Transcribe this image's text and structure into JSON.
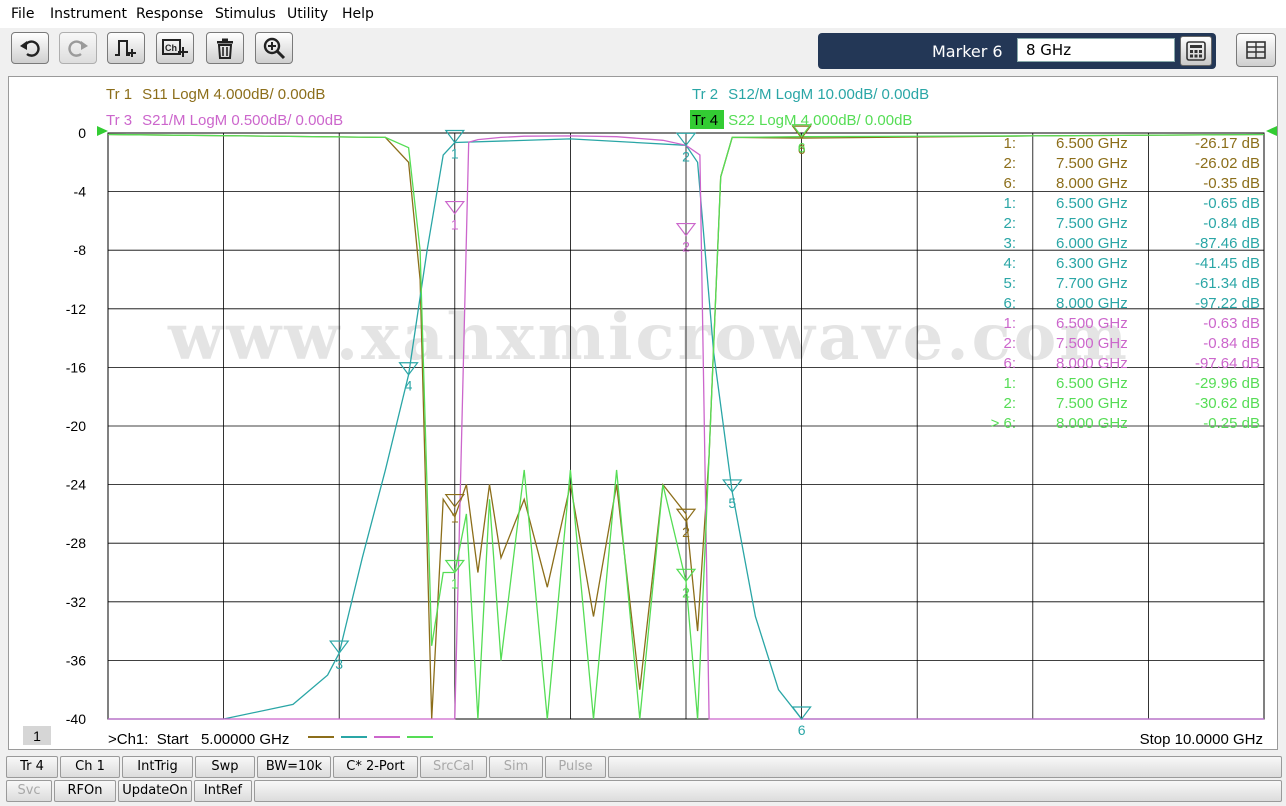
{
  "menu": [
    "File",
    "Instrument",
    "Response",
    "Stimulus",
    "Utility",
    "Help"
  ],
  "toolbar": {
    "buttons": [
      {
        "name": "undo-button",
        "icon": "undo-icon",
        "disabled": false
      },
      {
        "name": "redo-button",
        "icon": "redo-icon",
        "disabled": true
      },
      {
        "name": "add-trace-button",
        "icon": "add-trace-icon",
        "disabled": false
      },
      {
        "name": "add-channel-button",
        "icon": "add-channel-icon",
        "disabled": false
      },
      {
        "name": "delete-button",
        "icon": "trash-icon",
        "disabled": false
      },
      {
        "name": "zoom-button",
        "icon": "zoom-icon",
        "disabled": false
      }
    ],
    "marker_label": "Marker 6",
    "marker_value": "8 GHz"
  },
  "traces": {
    "tr1": {
      "id": "Tr  1",
      "desc": "S11 LogM 4.000dB/  0.00dB",
      "color": "#8c6e1a"
    },
    "tr2": {
      "id": "Tr  2",
      "desc": "S12/M LogM 10.00dB/  0.00dB",
      "color": "#2aa6a6"
    },
    "tr3": {
      "id": "Tr  3",
      "desc": "S21/M LogM 0.500dB/  0.00dB",
      "color": "#cc66cc"
    },
    "tr4": {
      "id": "Tr  4",
      "desc": "S22 LogM 4.000dB/  0.00dB",
      "color": "#55dd55"
    }
  },
  "chart_data": {
    "type": "line",
    "xlim": [
      5.0,
      10.0
    ],
    "ylim": [
      -40,
      0
    ],
    "yticks": [
      "0",
      "-4",
      "-8",
      "-12",
      "-16",
      "-20",
      "-24",
      "-28",
      "-32",
      "-36",
      "-40"
    ],
    "series": [
      {
        "name": "S11",
        "color": "#8c6e1a",
        "x": [
          5.0,
          6.2,
          6.3,
          6.35,
          6.4,
          6.45,
          6.5,
          6.55,
          6.6,
          6.65,
          6.7,
          6.8,
          6.9,
          7.0,
          7.1,
          7.2,
          7.3,
          7.4,
          7.5,
          7.55,
          7.6,
          7.65,
          7.7,
          8.0,
          9.0,
          10.0
        ],
        "y": [
          -0.1,
          -0.3,
          -2,
          -10,
          -40,
          -25,
          -26.2,
          -24,
          -30,
          -24,
          -29,
          -25,
          -31,
          -24,
          -33,
          -24,
          -38,
          -24,
          -26,
          -34,
          -22,
          -3,
          -0.3,
          -0.35,
          -0.2,
          -0.1
        ]
      },
      {
        "name": "S12",
        "color": "#2aa6a6",
        "x": [
          5.0,
          5.5,
          5.8,
          5.95,
          6.0,
          6.1,
          6.2,
          6.3,
          6.38,
          6.45,
          6.5,
          7.0,
          7.5,
          7.55,
          7.62,
          7.7,
          7.8,
          7.9,
          8.0,
          8.2,
          8.5,
          9.0,
          9.5,
          10.0
        ],
        "y": [
          -40,
          -40,
          -39,
          -37,
          -35.5,
          -29,
          -23,
          -16.5,
          -8,
          -1.5,
          -0.65,
          -0.4,
          -0.84,
          -2,
          -15,
          -24.5,
          -33,
          -38,
          -40,
          -40,
          -40,
          -40,
          -40,
          -40
        ]
      },
      {
        "name": "S21",
        "color": "#cc66cc",
        "x": [
          5.0,
          6.5,
          6.56,
          6.6,
          6.7,
          6.8,
          7.0,
          7.2,
          7.4,
          7.5,
          7.56,
          7.6,
          10.0
        ],
        "y": [
          -40,
          -40,
          -0.63,
          -0.45,
          -0.3,
          -0.22,
          -0.2,
          -0.25,
          -0.5,
          -0.84,
          -1.5,
          -40,
          -40
        ]
      },
      {
        "name": "S22",
        "color": "#55dd55",
        "x": [
          5.0,
          6.2,
          6.3,
          6.35,
          6.4,
          6.45,
          6.5,
          6.55,
          6.6,
          6.65,
          6.7,
          6.8,
          6.9,
          7.0,
          7.1,
          7.2,
          7.3,
          7.4,
          7.5,
          7.55,
          7.6,
          7.65,
          7.7,
          8.0,
          9.0,
          10.0
        ],
        "y": [
          -0.1,
          -0.3,
          -1,
          -8,
          -35,
          -30,
          -30,
          -26,
          -40,
          -25,
          -36,
          -23,
          -40,
          -23,
          -40,
          -23,
          -40,
          -24,
          -30.6,
          -40,
          -22,
          -3,
          -0.3,
          -0.25,
          -0.2,
          -0.1
        ]
      }
    ],
    "markers": [
      {
        "label": "1",
        "trace": "S12",
        "x": 6.5,
        "y": -0.65
      },
      {
        "label": "2",
        "trace": "S12",
        "x": 7.5,
        "y": -0.84
      },
      {
        "label": "3",
        "trace": "S12",
        "x": 6.0,
        "y": -35.5
      },
      {
        "label": "4",
        "trace": "S12",
        "x": 6.3,
        "y": -16.5
      },
      {
        "label": "5",
        "trace": "S12",
        "x": 7.7,
        "y": -24.5
      },
      {
        "label": "6",
        "trace": "S12",
        "x": 8.0,
        "y": -40
      },
      {
        "label": "1",
        "trace": "S21",
        "x": 6.5,
        "y": -5.5
      },
      {
        "label": "2",
        "trace": "S21",
        "x": 7.5,
        "y": -7.0
      },
      {
        "label": "1",
        "trace": "S11",
        "x": 6.5,
        "y": -25.5
      },
      {
        "label": "2",
        "trace": "S11",
        "x": 7.5,
        "y": -26.5
      },
      {
        "label": "6",
        "trace": "S11",
        "x": 8.0,
        "y": -0.35
      },
      {
        "label": "1",
        "trace": "S22",
        "x": 6.5,
        "y": -30
      },
      {
        "label": "2",
        "trace": "S22",
        "x": 7.5,
        "y": -30.6
      },
      {
        "label": "6",
        "trace": "S22",
        "x": 8.0,
        "y": -0.25
      }
    ],
    "marker_readouts": [
      {
        "n": "1:",
        "f": "6.500  GHz",
        "v": "-26.17 dB",
        "color": "#8c6e1a"
      },
      {
        "n": "2:",
        "f": "7.500  GHz",
        "v": "-26.02 dB",
        "color": "#8c6e1a"
      },
      {
        "n": "6:",
        "f": "8.000  GHz",
        "v": "-0.35 dB",
        "color": "#8c6e1a"
      },
      {
        "n": "1:",
        "f": "6.500  GHz",
        "v": "-0.65 dB",
        "color": "#2aa6a6"
      },
      {
        "n": "2:",
        "f": "7.500  GHz",
        "v": "-0.84 dB",
        "color": "#2aa6a6"
      },
      {
        "n": "3:",
        "f": "6.000  GHz",
        "v": "-87.46 dB",
        "color": "#2aa6a6"
      },
      {
        "n": "4:",
        "f": "6.300  GHz",
        "v": "-41.45 dB",
        "color": "#2aa6a6"
      },
      {
        "n": "5:",
        "f": "7.700  GHz",
        "v": "-61.34 dB",
        "color": "#2aa6a6"
      },
      {
        "n": "6:",
        "f": "8.000  GHz",
        "v": "-97.22 dB",
        "color": "#2aa6a6"
      },
      {
        "n": "1:",
        "f": "6.500  GHz",
        "v": "-0.63 dB",
        "color": "#cc66cc"
      },
      {
        "n": "2:",
        "f": "7.500  GHz",
        "v": "-0.84 dB",
        "color": "#cc66cc"
      },
      {
        "n": "6:",
        "f": "8.000  GHz",
        "v": "-97.64 dB",
        "color": "#cc66cc"
      },
      {
        "n": "1:",
        "f": "6.500  GHz",
        "v": "-29.96 dB",
        "color": "#55dd55"
      },
      {
        "n": "2:",
        "f": "7.500  GHz",
        "v": "-30.62 dB",
        "color": "#55dd55"
      },
      {
        "n": ">  6:",
        "f": "8.000  GHz",
        "v": "-0.25 dB",
        "color": "#55dd55"
      }
    ],
    "watermark": "www.xahxmicrowave.com",
    "channel_number": "1",
    "start_label": ">Ch1:  Start   5.00000 GHz",
    "stop_label": "Stop  10.0000 GHz"
  },
  "statusbar": {
    "row1": [
      {
        "label": "Tr 4",
        "disabled": false
      },
      {
        "label": "Ch 1",
        "disabled": false
      },
      {
        "label": "IntTrig",
        "disabled": false
      },
      {
        "label": "Swp",
        "disabled": false
      },
      {
        "label": "BW=10k",
        "disabled": false
      },
      {
        "label": "C* 2-Port",
        "disabled": false
      },
      {
        "label": "SrcCal",
        "disabled": true
      },
      {
        "label": "Sim",
        "disabled": true
      },
      {
        "label": "Pulse",
        "disabled": true
      }
    ],
    "row2": [
      {
        "label": "Svc",
        "disabled": true
      },
      {
        "label": "RFOn",
        "disabled": false
      },
      {
        "label": "UpdateOn",
        "disabled": false
      },
      {
        "label": "IntRef",
        "disabled": false
      }
    ]
  }
}
